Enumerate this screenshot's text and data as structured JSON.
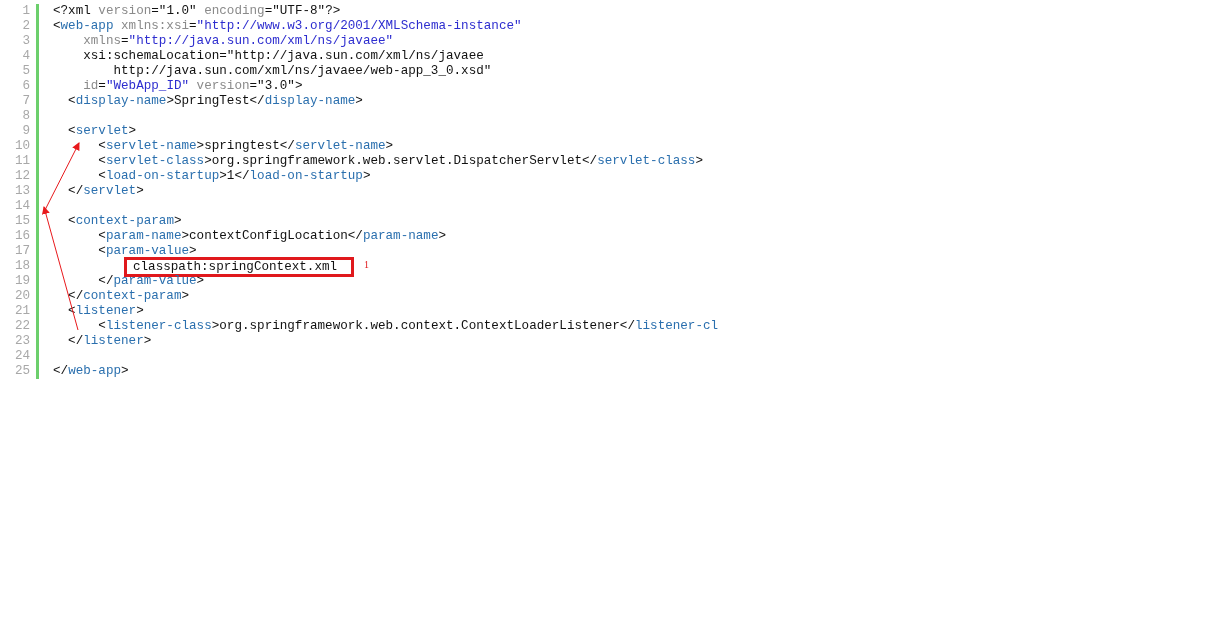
{
  "editor": {
    "lines": [
      {
        "n": "1",
        "tokens": [
          {
            "kind": "p",
            "text": "<?xml"
          },
          {
            "kind": "attr",
            "text": " version"
          },
          {
            "kind": "p",
            "text": "="
          },
          {
            "kind": "text",
            "text": "\"1.0\""
          },
          {
            "kind": "attr",
            "text": " encoding"
          },
          {
            "kind": "p",
            "text": "="
          },
          {
            "kind": "text",
            "text": "\"UTF-8\""
          },
          {
            "kind": "p",
            "text": "?>"
          }
        ]
      },
      {
        "n": "2",
        "tokens": [
          {
            "kind": "p",
            "text": "<"
          },
          {
            "kind": "tag",
            "text": "web-app"
          },
          {
            "kind": "attr",
            "text": " xmlns:xsi"
          },
          {
            "kind": "p",
            "text": "="
          },
          {
            "kind": "val",
            "text": "\"http://www.w3.org/2001/XMLSchema-instance\""
          }
        ]
      },
      {
        "n": "3",
        "tokens": [
          {
            "kind": "attr",
            "text": "    xmlns"
          },
          {
            "kind": "p",
            "text": "="
          },
          {
            "kind": "val",
            "text": "\"http://java.sun.com/xml/ns/javaee\""
          }
        ]
      },
      {
        "n": "4",
        "tokens": [
          {
            "kind": "text",
            "text": "    xsi:schemaLocation=\"http://java.sun.com/xml/ns/javaee"
          }
        ]
      },
      {
        "n": "5",
        "tokens": [
          {
            "kind": "text",
            "text": "        http://java.sun.com/xml/ns/javaee/web-app_3_0.xsd\""
          }
        ]
      },
      {
        "n": "6",
        "tokens": [
          {
            "kind": "attr",
            "text": "    id"
          },
          {
            "kind": "p",
            "text": "="
          },
          {
            "kind": "val",
            "text": "\"WebApp_ID\""
          },
          {
            "kind": "attr",
            "text": " version"
          },
          {
            "kind": "p",
            "text": "="
          },
          {
            "kind": "text",
            "text": "\"3.0\""
          },
          {
            "kind": "p",
            "text": ">"
          }
        ]
      },
      {
        "n": "7",
        "tokens": [
          {
            "kind": "p",
            "text": "  <"
          },
          {
            "kind": "tag",
            "text": "display-name"
          },
          {
            "kind": "p",
            "text": ">"
          },
          {
            "kind": "text",
            "text": "SpringTest"
          },
          {
            "kind": "p",
            "text": "</"
          },
          {
            "kind": "tag",
            "text": "display-name"
          },
          {
            "kind": "p",
            "text": ">"
          }
        ]
      },
      {
        "n": "8"
      },
      {
        "n": "9",
        "tokens": [
          {
            "kind": "p",
            "text": "  <"
          },
          {
            "kind": "tag",
            "text": "servlet"
          },
          {
            "kind": "p",
            "text": ">"
          }
        ]
      },
      {
        "n": "10",
        "tokens": [
          {
            "kind": "p",
            "text": "      <"
          },
          {
            "kind": "tag",
            "text": "servlet-name"
          },
          {
            "kind": "p",
            "text": ">"
          },
          {
            "kind": "text",
            "text": "springtest"
          },
          {
            "kind": "p",
            "text": "</"
          },
          {
            "kind": "tag",
            "text": "servlet-name"
          },
          {
            "kind": "p",
            "text": ">"
          }
        ]
      },
      {
        "n": "11",
        "tokens": [
          {
            "kind": "p",
            "text": "      <"
          },
          {
            "kind": "tag",
            "text": "servlet-class"
          },
          {
            "kind": "p",
            "text": ">"
          },
          {
            "kind": "text",
            "text": "org.springframework.web.servlet.DispatcherServlet"
          },
          {
            "kind": "p",
            "text": "</"
          },
          {
            "kind": "tag",
            "text": "servlet-class"
          },
          {
            "kind": "p",
            "text": ">"
          }
        ]
      },
      {
        "n": "12",
        "tokens": [
          {
            "kind": "p",
            "text": "      <"
          },
          {
            "kind": "tag",
            "text": "load-on-startup"
          },
          {
            "kind": "p",
            "text": ">"
          },
          {
            "kind": "text",
            "text": "1"
          },
          {
            "kind": "p",
            "text": "</"
          },
          {
            "kind": "tag",
            "text": "load-on-startup"
          },
          {
            "kind": "p",
            "text": ">"
          }
        ]
      },
      {
        "n": "13",
        "tokens": [
          {
            "kind": "p",
            "text": "  </"
          },
          {
            "kind": "tag",
            "text": "servlet"
          },
          {
            "kind": "p",
            "text": ">"
          }
        ]
      },
      {
        "n": "14"
      },
      {
        "n": "15",
        "tokens": [
          {
            "kind": "p",
            "text": "  <"
          },
          {
            "kind": "tag",
            "text": "context-param"
          },
          {
            "kind": "p",
            "text": ">"
          }
        ]
      },
      {
        "n": "16",
        "tokens": [
          {
            "kind": "p",
            "text": "      <"
          },
          {
            "kind": "tag",
            "text": "param-name"
          },
          {
            "kind": "p",
            "text": ">"
          },
          {
            "kind": "text",
            "text": "contextConfigLocation"
          },
          {
            "kind": "p",
            "text": "</"
          },
          {
            "kind": "tag",
            "text": "param-name"
          },
          {
            "kind": "p",
            "text": ">"
          }
        ]
      },
      {
        "n": "17",
        "tokens": [
          {
            "kind": "p",
            "text": "      <"
          },
          {
            "kind": "tag",
            "text": "param-value"
          },
          {
            "kind": "p",
            "text": ">"
          }
        ]
      },
      {
        "n": "18",
        "tokens": [
          {
            "kind": "boxed",
            "text": "classpath:springContext.xml"
          }
        ],
        "annotation": "1"
      },
      {
        "n": "19",
        "tokens": [
          {
            "kind": "p",
            "text": "      </"
          },
          {
            "kind": "tag",
            "text": "param-value"
          },
          {
            "kind": "p",
            "text": ">"
          }
        ]
      },
      {
        "n": "20",
        "tokens": [
          {
            "kind": "p",
            "text": "  </"
          },
          {
            "kind": "tag",
            "text": "context-param"
          },
          {
            "kind": "p",
            "text": ">"
          }
        ]
      },
      {
        "n": "21",
        "tokens": [
          {
            "kind": "p",
            "text": "  <"
          },
          {
            "kind": "tag",
            "text": "listener"
          },
          {
            "kind": "p",
            "text": ">"
          }
        ]
      },
      {
        "n": "22",
        "tokens": [
          {
            "kind": "p",
            "text": "      <"
          },
          {
            "kind": "tag",
            "text": "listener-class"
          },
          {
            "kind": "p",
            "text": ">"
          },
          {
            "kind": "text",
            "text": "org.springframework.web.context.ContextLoaderListener"
          },
          {
            "kind": "p",
            "text": "</"
          },
          {
            "kind": "tag",
            "text": "listener-cl"
          }
        ]
      },
      {
        "n": "23",
        "tokens": [
          {
            "kind": "p",
            "text": "  </"
          },
          {
            "kind": "tag",
            "text": "listener"
          },
          {
            "kind": "p",
            "text": ">"
          }
        ]
      },
      {
        "n": "24"
      },
      {
        "n": "25",
        "tokens": [
          {
            "kind": "p",
            "text": "</"
          },
          {
            "kind": "tag",
            "text": "web-app"
          },
          {
            "kind": "p",
            "text": ">"
          }
        ]
      }
    ]
  }
}
